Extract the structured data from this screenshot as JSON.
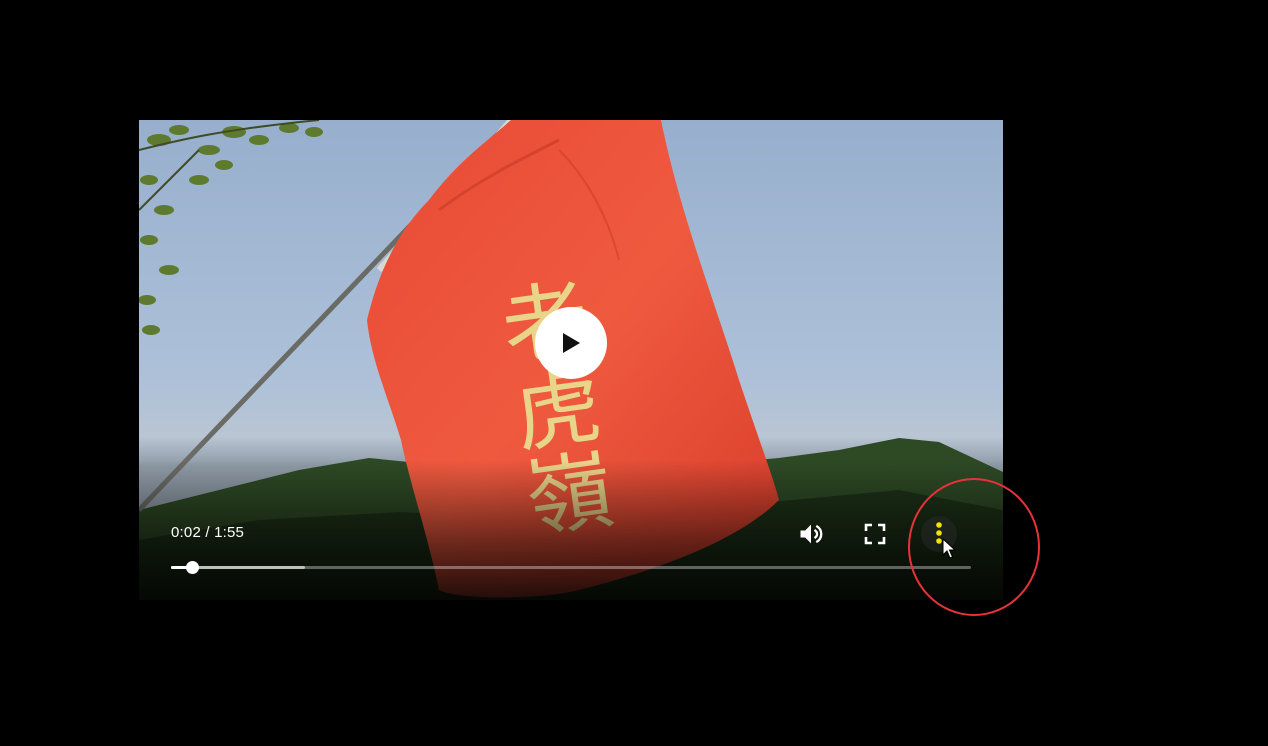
{
  "player": {
    "time_display": "0:02 / 1:55",
    "progress": {
      "played_fraction": 0.026,
      "buffered_fraction": 0.168
    },
    "flag_text": "老虎嶺",
    "controls": {
      "play_icon": "play-icon",
      "volume_icon": "volume-icon",
      "fullscreen_icon": "fullscreen-icon",
      "more_icon": "more-options-icon"
    }
  },
  "colors": {
    "page_background": "#000000",
    "flag_red": "#e8412f",
    "flag_text": "#e9d58a",
    "annotation_circle": "#e8323a",
    "more_icon_dots": "#f2e400"
  }
}
